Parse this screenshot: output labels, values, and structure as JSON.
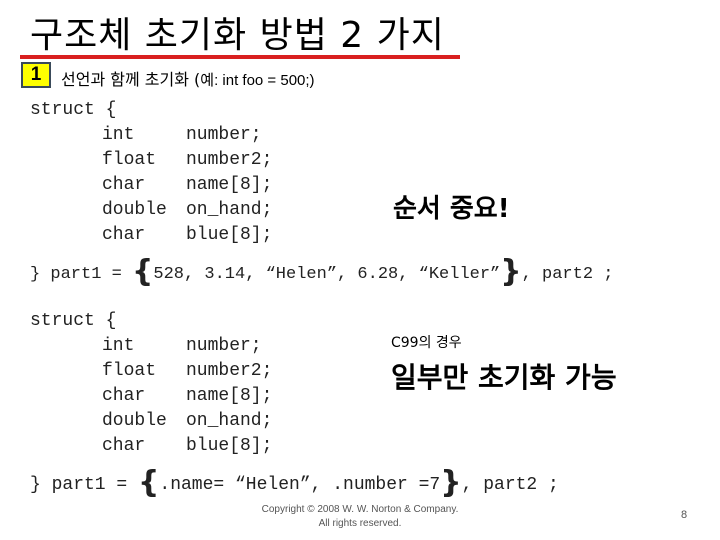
{
  "slide": {
    "title": "구조체 초기화 방법 2 가지",
    "colors": {
      "title_rule": "#d92020",
      "badge_fill": "#ffff00",
      "badge_border": "#3a4a5a"
    },
    "section1": {
      "badge": "1",
      "heading": "선언과 함께 초기화 (",
      "heading_example": "예: int foo = 500;)"
    },
    "example1": {
      "open": "struct {",
      "members": [
        {
          "type": "int",
          "field": "number;"
        },
        {
          "type": "float",
          "field": "number2;"
        },
        {
          "type": "char",
          "field": "name[8];"
        },
        {
          "type": "double",
          "field": "on_hand;"
        },
        {
          "type": "char",
          "field": "blue[8];"
        }
      ],
      "close_prefix": "} part1 = ",
      "brace_open": "{",
      "initializer": "528, 3.14, “Helen”, 6.28, “Keller”",
      "brace_close": "}",
      "close_suffix": ", part2 ;",
      "callout": "순서 중요!"
    },
    "example2": {
      "open": "struct {",
      "members": [
        {
          "type": "int",
          "field": "number;"
        },
        {
          "type": "float",
          "field": "number2;"
        },
        {
          "type": "char",
          "field": "name[8];"
        },
        {
          "type": "double",
          "field": "on_hand;"
        },
        {
          "type": "char",
          "field": "blue[8];"
        }
      ],
      "close_prefix": "} part1 = ",
      "brace_open": "{",
      "initializer": ".name= “Helen”, .number =7",
      "brace_close": "}",
      "close_suffix": ", part2 ;",
      "callout_small": "C99의 경우",
      "callout": "일부만 초기화 가능"
    },
    "footer": {
      "line1": "Copyright © 2008 W. W. Norton & Company.",
      "line2": "All rights reserved."
    },
    "page_number": "8"
  }
}
